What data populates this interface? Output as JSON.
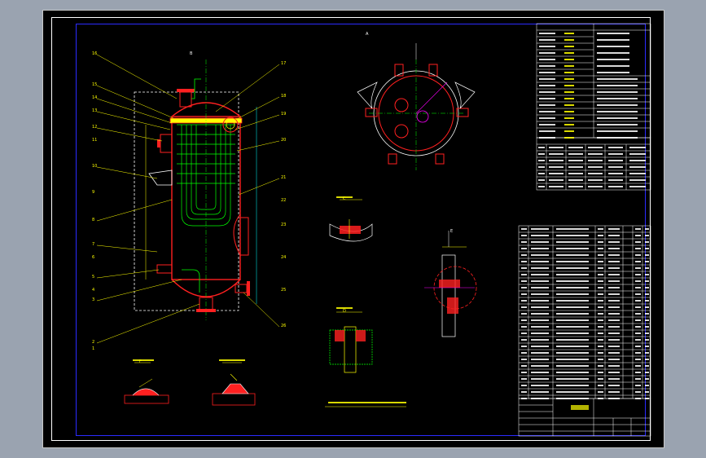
{
  "app": {
    "viewport_bg": "#000000",
    "colors": {
      "outline": "#ffffff",
      "shell": "#ff2020",
      "tube": "#00ff00",
      "leader": "#ffff00",
      "dim": "#00ffff",
      "frame": "#2b2bff",
      "hatch": "#ff0000",
      "magenta": "#ff00ff"
    }
  },
  "drawing": {
    "balloon_numbers_left": [
      "16",
      "15",
      "14",
      "13",
      "12",
      "11",
      "10",
      "9",
      "8",
      "7",
      "6",
      "5",
      "4",
      "3",
      "2",
      "1"
    ],
    "balloon_numbers_right": [
      "17",
      "18",
      "19",
      "20",
      "21",
      "22",
      "23",
      "24",
      "25",
      "26"
    ],
    "view_letters": [
      "A",
      "B",
      "C",
      "D",
      "E",
      "F"
    ],
    "icons": [
      "vessel-icon",
      "flange-icon",
      "nozzle-icon",
      "weld-detail-icon",
      "section-view-icon"
    ]
  },
  "title_block": {
    "drawing_title": "",
    "scale": "",
    "sheet": ""
  }
}
